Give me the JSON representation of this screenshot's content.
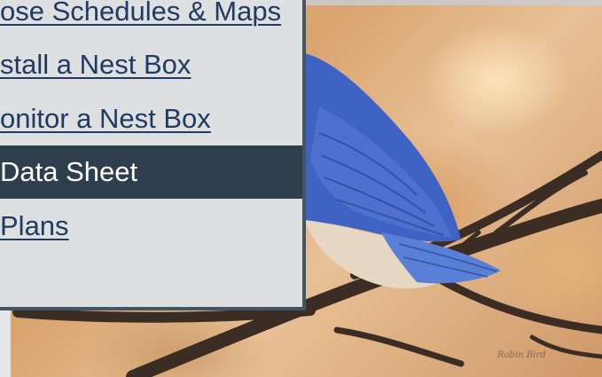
{
  "menu": {
    "items": [
      {
        "label": "ose Schedules & Maps",
        "active": false
      },
      {
        "label": "stall a Nest Box",
        "active": false
      },
      {
        "label": "onitor a Nest Box",
        "active": false
      },
      {
        "label": "Data Sheet",
        "active": true
      },
      {
        "label": "Plans",
        "active": false
      }
    ]
  },
  "photo": {
    "subject": "eastern-bluebird",
    "signature": "Robin Bird"
  },
  "colors": {
    "menu_background": "#dedfe1",
    "menu_border": "#415563",
    "link_color": "#203a62",
    "active_background": "#2f3e4d",
    "active_text": "#ffffff",
    "bird_blue": "#3f63c4"
  }
}
